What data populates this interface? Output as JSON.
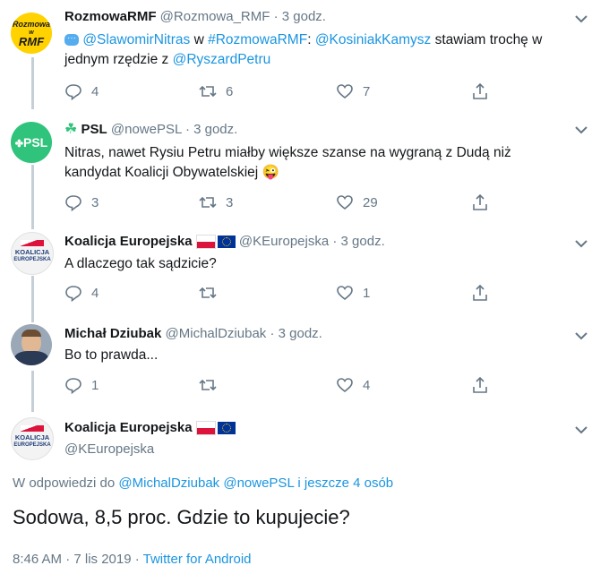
{
  "tweets": [
    {
      "name": "RozmowaRMF",
      "handle": "@Rozmowa_RMF",
      "sep": "·",
      "time": "3 godz.",
      "text_link1": "@SlawomirNitras",
      "text_mid1": " w ",
      "text_link2": "#RozmowaRMF",
      "text_mid2": ": ",
      "text_link3": "@KosiniakKamysz",
      "text_mid3": " stawiam trochę w",
      "text_line2": "jednym rzędzie z ",
      "text_link4": "@RyszardPetru",
      "avatar_text1": "Rozmowa",
      "avatar_text2": "w",
      "avatar_text3": "RMF",
      "replies": "4",
      "retweets": "6",
      "likes": "7"
    },
    {
      "name": "PSL",
      "handle": "@nowePSL",
      "sep": "·",
      "time": "3 godz.",
      "text_line1": "Nitras, nawet Rysiu Petru miałby większe szanse na wygraną z Dudą niż",
      "text_line2": "kandydat Koalicji Obywatelskiej 😜",
      "avatar_text": "PSL",
      "replies": "3",
      "retweets": "3",
      "likes": "29"
    },
    {
      "name": "Koalicja Europejska",
      "handle": "@KEuropejska",
      "sep": "·",
      "time": "3 godz.",
      "text_line1": "A dlaczego tak sądzicie?",
      "avatar_text1": "KOALICJA",
      "avatar_text2": "EUROPEJSKA",
      "replies": "4",
      "retweets": "",
      "likes": "1"
    },
    {
      "name": "Michał Dziubak",
      "handle": "@MichalDziubak",
      "sep": "·",
      "time": "3 godz.",
      "text_line1": "Bo to prawda...",
      "replies": "1",
      "retweets": "",
      "likes": "4"
    }
  ],
  "main": {
    "name": "Koalicja Europejska",
    "handle": "@KEuropejska",
    "avatar_text1": "KOALICJA",
    "avatar_text2": "EUROPEJSKA",
    "reply_prefix": "W odpowiedzi do ",
    "reply_link1": "@MichalDziubak",
    "reply_link2": "@nowePSL",
    "reply_link3": "i jeszcze 4 osób",
    "text": "Sodowa, 8,5 proc. Gdzie to kupujecie?",
    "timestamp": "8:46 AM · 7 lis 2019 · ",
    "source": "Twitter for Android"
  },
  "colors": {
    "link": "#1b95e0",
    "muted": "#657786",
    "psl_green": "#2fc37b",
    "rmf_yellow": "#ffd200"
  }
}
